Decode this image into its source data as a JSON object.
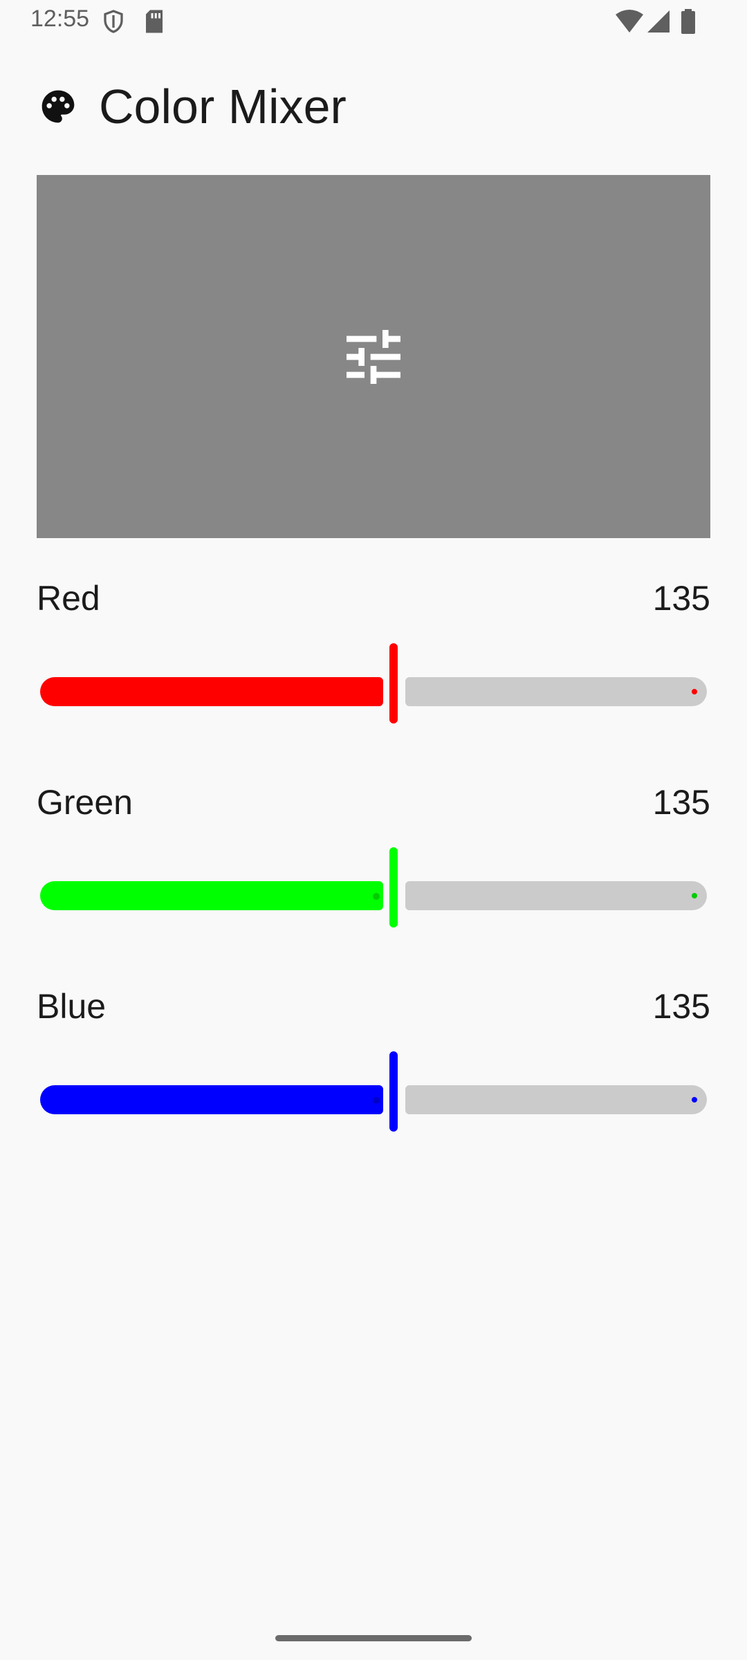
{
  "status_bar": {
    "time": "12:55",
    "icons": [
      "shield-icon",
      "sd-card-icon",
      "wifi-icon",
      "signal-icon",
      "battery-icon"
    ]
  },
  "app": {
    "title": "Color Mixer",
    "icon": "palette-icon"
  },
  "preview": {
    "color": "#878787",
    "icon": "tune-icon"
  },
  "sliders": [
    {
      "label": "Red",
      "value": "135",
      "fraction": 0.529,
      "color": "#ff0000"
    },
    {
      "label": "Green",
      "value": "135",
      "fraction": 0.529,
      "color": "#00ff00"
    },
    {
      "label": "Blue",
      "value": "135",
      "fraction": 0.529,
      "color": "#0000ff"
    }
  ],
  "colors": {
    "background": "#f9f9f9",
    "inactive_track": "#cbcbcb"
  }
}
